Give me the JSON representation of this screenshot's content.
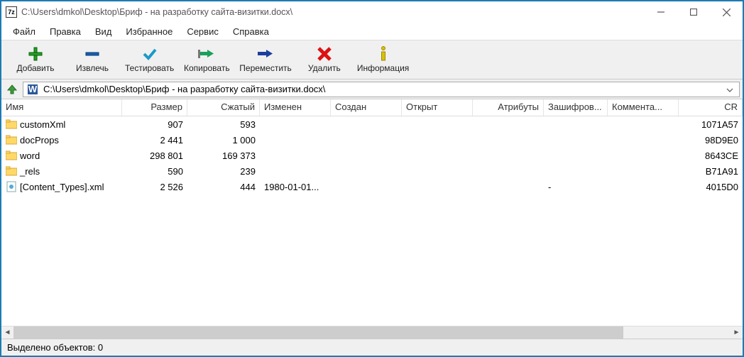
{
  "title": "C:\\Users\\dmkol\\Desktop\\Бриф - на разработку сайта-визитки.docx\\",
  "menu": [
    "Файл",
    "Правка",
    "Вид",
    "Избранное",
    "Сервис",
    "Справка"
  ],
  "toolbar": [
    {
      "label": "Добавить"
    },
    {
      "label": "Извлечь"
    },
    {
      "label": "Тестировать"
    },
    {
      "label": "Копировать"
    },
    {
      "label": "Переместить"
    },
    {
      "label": "Удалить"
    },
    {
      "label": "Информация"
    }
  ],
  "path": "C:\\Users\\dmkol\\Desktop\\Бриф - на разработку сайта-визитки.docx\\",
  "columns": {
    "name": "Имя",
    "size": "Размер",
    "packed": "Сжатый",
    "modified": "Изменен",
    "created": "Создан",
    "opened": "Открыт",
    "attr": "Атрибуты",
    "enc": "Зашифров...",
    "comment": "Коммента...",
    "crc": "CR"
  },
  "rows": [
    {
      "type": "folder",
      "name": "customXml",
      "size": "907",
      "packed": "593",
      "modified": "",
      "enc": "",
      "crc": "1071A57"
    },
    {
      "type": "folder",
      "name": "docProps",
      "size": "2 441",
      "packed": "1 000",
      "modified": "",
      "enc": "",
      "crc": "98D9E0"
    },
    {
      "type": "folder",
      "name": "word",
      "size": "298 801",
      "packed": "169 373",
      "modified": "",
      "enc": "",
      "crc": "8643CE"
    },
    {
      "type": "folder",
      "name": "_rels",
      "size": "590",
      "packed": "239",
      "modified": "",
      "enc": "",
      "crc": "B71A91"
    },
    {
      "type": "file",
      "name": "[Content_Types].xml",
      "size": "2 526",
      "packed": "444",
      "modified": "1980-01-01...",
      "enc": "-",
      "crc": "4015D0"
    }
  ],
  "status": "Выделено объектов: 0"
}
